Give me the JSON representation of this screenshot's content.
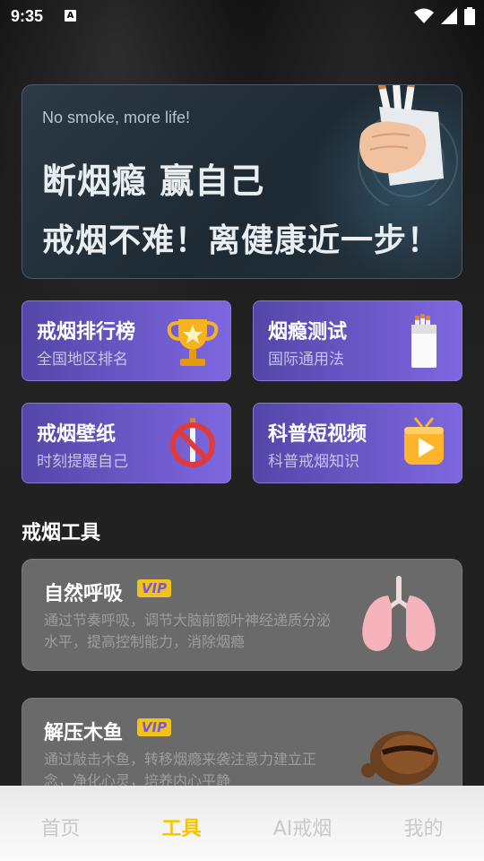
{
  "status": {
    "time": "9:35",
    "notification_badge": "A"
  },
  "banner": {
    "subtitle": "No smoke, more life!",
    "line1": "断烟瘾  赢自己",
    "line2": "戒烟不难！离健康近一步！"
  },
  "cards": [
    {
      "title": "戒烟排行榜",
      "subtitle": "全国地区排名",
      "icon": "trophy-icon"
    },
    {
      "title": "烟瘾测试",
      "subtitle": "国际通用法",
      "icon": "cigarette-pack-icon"
    },
    {
      "title": "戒烟壁纸",
      "subtitle": "时刻提醒自己",
      "icon": "no-smoking-icon"
    },
    {
      "title": "科普短视频",
      "subtitle": "科普戒烟知识",
      "icon": "video-play-icon"
    }
  ],
  "section": {
    "title": "戒烟工具"
  },
  "tools": [
    {
      "title": "自然呼吸",
      "badge": "VIP",
      "desc": "通过节奏呼吸，调节大脑前额叶神经递质分泌水平，提高控制能力，消除烟瘾",
      "icon": "lungs-icon"
    },
    {
      "title": "解压木鱼",
      "badge": "VIP",
      "desc": "通过敲击木鱼，转移烟瘾来袭注意力建立正念，净化心灵，培养内心平静",
      "icon": "wooden-fish-icon"
    }
  ],
  "nav": {
    "items": [
      {
        "label": "首页"
      },
      {
        "label": "工具"
      },
      {
        "label": "AI戒烟"
      },
      {
        "label": "我的"
      }
    ],
    "active_index": 1
  },
  "colors": {
    "accent": "#f5c400",
    "card_purple": "#6f58d0",
    "vip_gold": "#f1c21b"
  }
}
